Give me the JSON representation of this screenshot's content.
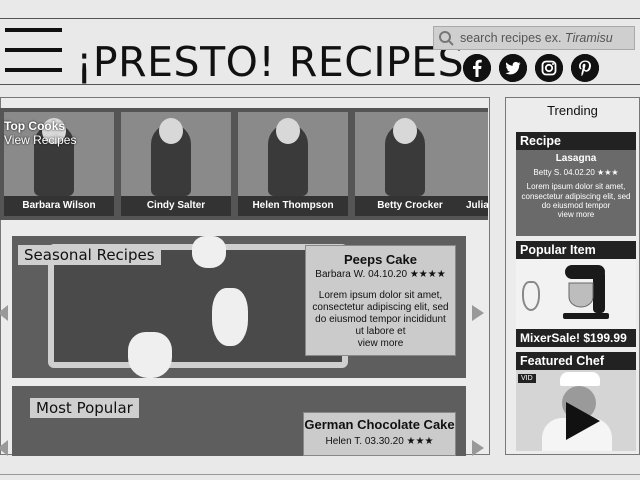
{
  "header": {
    "brand": "¡PRESTO! RECIPES",
    "search_placeholder": "search recipes ex. ",
    "search_example": "Tiramisu",
    "social": [
      {
        "name": "facebook-icon",
        "glyph": "f"
      },
      {
        "name": "twitter-icon",
        "glyph": "t"
      },
      {
        "name": "instagram-icon",
        "glyph": "◎"
      },
      {
        "name": "pinterest-icon",
        "glyph": "p"
      }
    ]
  },
  "top_cooks": {
    "title": "Top Cooks",
    "link": "View Recipes",
    "cooks": [
      "Barbara Wilson",
      "Cindy Salter",
      "Helen Thompson",
      "Betty Crocker",
      "Julia"
    ]
  },
  "seasonal": {
    "label": "Seasonal Recipes",
    "card": {
      "title": "Peeps Cake",
      "author": "Barbara W.",
      "date": "04.10.20",
      "stars": "★★★★",
      "body": "Lorem ipsum dolor sit amet, consectetur adipiscing elit, sed do eiusmod tempor incididunt ut labore et",
      "more": "view more"
    }
  },
  "most_popular": {
    "label": "Most Popular",
    "card": {
      "title": "German Chocolate Cake",
      "author": "Helen T.",
      "date": "03.30.20",
      "stars": "★★★"
    }
  },
  "sidebar": {
    "title": "Trending",
    "recipe": {
      "header": "Recipe",
      "title": "Lasagna",
      "author": "Betty S.",
      "date": "04.02.20",
      "stars": "★★★",
      "body": "Lorem ipsum dolor sit amet, consectetur adipiscing elit, sed do eiusmod tempor",
      "more": "view more"
    },
    "popular_item": {
      "header": "Popular Item",
      "caption": "MixerSale! $199.99"
    },
    "featured_chef": {
      "header": "Featured Chef",
      "badge": "VID"
    }
  }
}
